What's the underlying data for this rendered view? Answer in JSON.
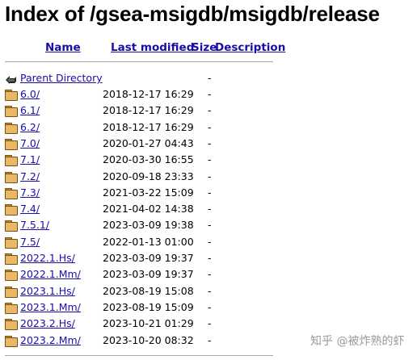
{
  "page": {
    "title": "Index of /gsea-msigdb/msigdb/release"
  },
  "columns": {
    "name": "Name",
    "last_modified": "Last modified",
    "size": "Size",
    "description": "Description"
  },
  "parent": {
    "label": "Parent Directory",
    "size": "-",
    "icon": "back-arrow-icon"
  },
  "entries": [
    {
      "name": "6.0/",
      "modified": "2018-12-17 16:29",
      "size": "-"
    },
    {
      "name": "6.1/",
      "modified": "2018-12-17 16:29",
      "size": "-"
    },
    {
      "name": "6.2/",
      "modified": "2018-12-17 16:29",
      "size": "-"
    },
    {
      "name": "7.0/",
      "modified": "2020-01-27 04:43",
      "size": "-"
    },
    {
      "name": "7.1/",
      "modified": "2020-03-30 16:55",
      "size": "-"
    },
    {
      "name": "7.2/",
      "modified": "2020-09-18 23:33",
      "size": "-"
    },
    {
      "name": "7.3/",
      "modified": "2021-03-22 15:09",
      "size": "-"
    },
    {
      "name": "7.4/",
      "modified": "2021-04-02 14:38",
      "size": "-"
    },
    {
      "name": "7.5.1/",
      "modified": "2023-03-09 19:38",
      "size": "-"
    },
    {
      "name": "7.5/",
      "modified": "2022-01-13 01:00",
      "size": "-"
    },
    {
      "name": "2022.1.Hs/",
      "modified": "2023-03-09 19:37",
      "size": "-"
    },
    {
      "name": "2022.1.Mm/",
      "modified": "2023-03-09 19:37",
      "size": "-"
    },
    {
      "name": "2023.1.Hs/",
      "modified": "2023-08-19 15:08",
      "size": "-"
    },
    {
      "name": "2023.1.Mm/",
      "modified": "2023-08-19 15:09",
      "size": "-"
    },
    {
      "name": "2023.2.Hs/",
      "modified": "2023-10-21 01:29",
      "size": "-"
    },
    {
      "name": "2023.2.Mm/",
      "modified": "2023-10-20 08:32",
      "size": "-"
    }
  ],
  "watermark": "知乎 @被炸熟的虾",
  "colors": {
    "link": "#1a0dab",
    "folder": "#e8b866",
    "rule": "#a8a8a8"
  }
}
